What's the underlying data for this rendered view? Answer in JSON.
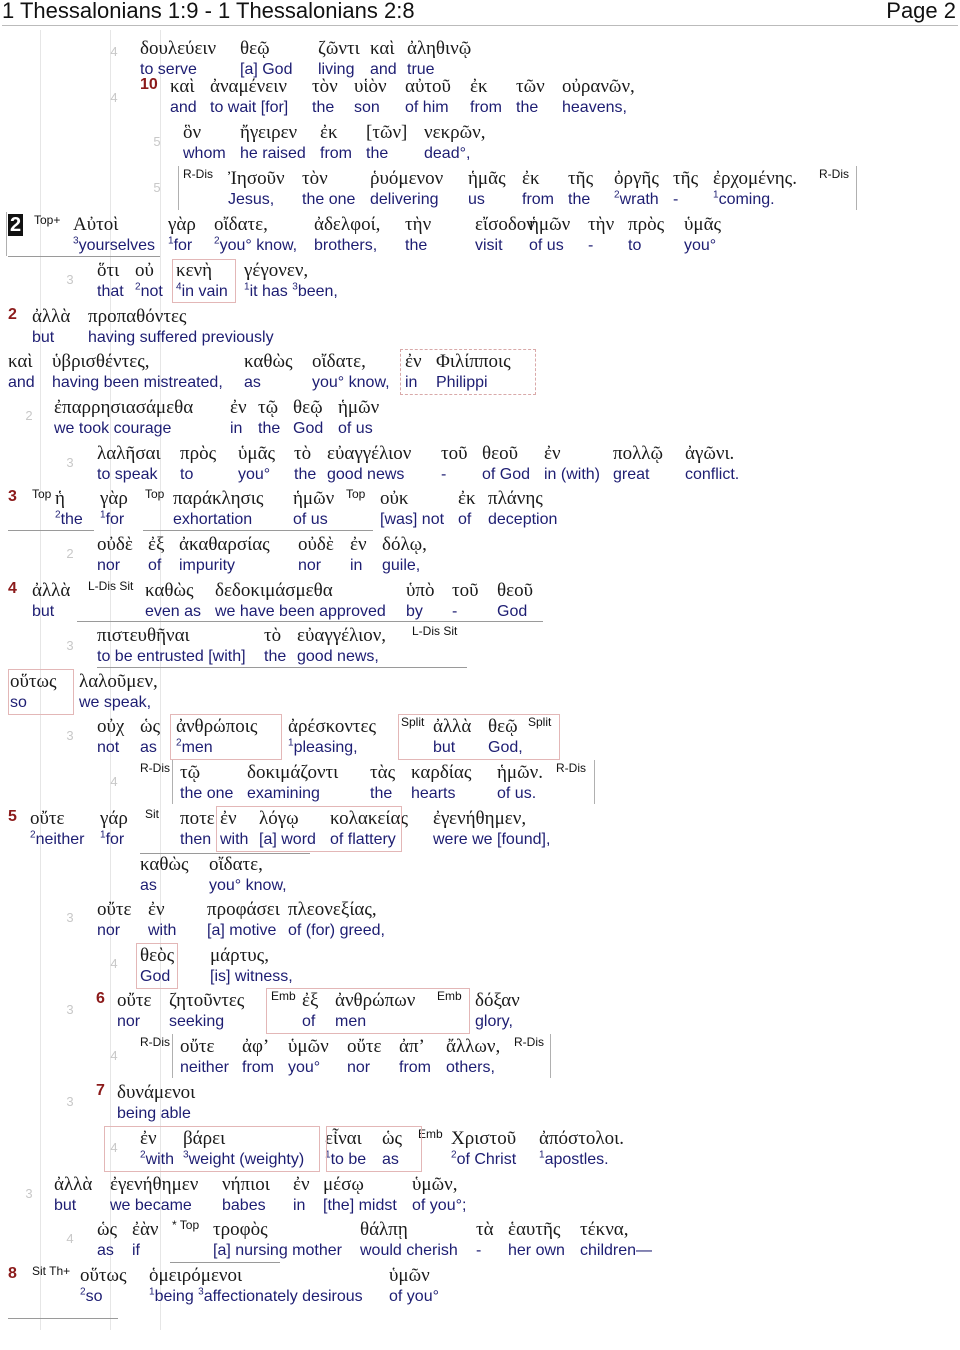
{
  "header": {
    "title": "1 Thessalonians 1:9 - 1 Thessalonians 2:8",
    "page": "Page 2"
  },
  "chapter_label": "2",
  "verses": [
    "10",
    "2",
    "3",
    "4",
    "5",
    "6",
    "7",
    "8"
  ],
  "tags": {
    "rdis": "R-Dis",
    "topplus": "Top+",
    "top": "Top",
    "ldissit": "L-Dis Sit",
    "split": "Split",
    "sit": "Sit",
    "emb": "Emb",
    "startop": "* Top",
    "sitth": "Sit Th+"
  },
  "levels": [
    "4",
    "4",
    "5",
    "5",
    "3",
    "2",
    "3",
    "2",
    "3",
    "3",
    "4",
    "3",
    "4",
    "3",
    "4",
    "3",
    "4",
    "3",
    "4",
    "2",
    "3"
  ],
  "lines": [
    [
      [
        "δουλεύειν",
        "to serve"
      ],
      [
        "θεῷ",
        "[a] God"
      ],
      [
        "ζῶντι",
        "living"
      ],
      [
        "καὶ",
        "and"
      ],
      [
        "ἀληθινῷ",
        "true"
      ]
    ],
    [
      [
        "καὶ",
        "and"
      ],
      [
        "ἀναμένειν",
        "to wait [for]"
      ],
      [
        "τὸν",
        "the"
      ],
      [
        "υἱὸν",
        "son"
      ],
      [
        "αὐτοῦ",
        "of him"
      ],
      [
        "ἐκ",
        "from"
      ],
      [
        "τῶν",
        "the"
      ],
      [
        "οὐρανῶν,",
        "heavens,"
      ]
    ],
    [
      [
        "ὃν",
        "whom"
      ],
      [
        "ἤγειρεν",
        "he raised"
      ],
      [
        "ἐκ",
        "from"
      ],
      [
        "[τῶν]",
        "the"
      ],
      [
        "νεκρῶν,",
        "dead°,"
      ]
    ],
    [
      [
        "Ἰησοῦν",
        "Jesus,"
      ],
      [
        "τὸν",
        "the one"
      ],
      [
        "ῥυόμενον",
        "delivering"
      ],
      [
        "ἡμᾶς",
        "us"
      ],
      [
        "ἐκ",
        "from"
      ],
      [
        "τῆς",
        "the"
      ],
      [
        "ὀργῆς",
        "²wrath"
      ],
      [
        "τῆς",
        "-"
      ],
      [
        "ἐρχομένης.",
        "¹coming."
      ]
    ],
    [
      [
        "Αὐτοὶ",
        "³yourselves"
      ],
      [
        "γὰρ",
        "¹for"
      ],
      [
        "οἴδατε,",
        "²you° know,"
      ],
      [
        "ἀδελφοί,",
        "brothers,"
      ],
      [
        "τὴν",
        "the"
      ],
      [
        "εἴσοδον",
        "visit"
      ],
      [
        "ἡμῶν",
        "of us"
      ],
      [
        "τὴν",
        "-"
      ],
      [
        "πρὸς",
        "to"
      ],
      [
        "ὑμᾶς",
        "you°"
      ]
    ],
    [
      [
        "ὅτι",
        "that"
      ],
      [
        "οὐ",
        "²not"
      ],
      [
        "κενὴ",
        "⁴in vain"
      ],
      [
        "γέγονεν,",
        "¹it has ³been,"
      ]
    ],
    [
      [
        "ἀλλὰ",
        "but"
      ],
      [
        "προπαθόντες",
        "having suffered previously"
      ]
    ],
    [
      [
        "καὶ",
        "and"
      ],
      [
        "ὑβρισθέντες,",
        "having been mistreated,"
      ],
      [
        "καθὼς",
        "as"
      ],
      [
        "οἴδατε,",
        "you° know,"
      ],
      [
        "ἐν",
        "in"
      ],
      [
        "Φιλίπποις",
        "Philippi"
      ]
    ],
    [
      [
        "ἐπαρρησιασάμεθα",
        "we took courage"
      ],
      [
        "ἐν",
        "in"
      ],
      [
        "τῷ",
        "the"
      ],
      [
        "θεῷ",
        "God"
      ],
      [
        "ἡμῶν",
        "of us"
      ]
    ],
    [
      [
        "λαλῆσαι",
        "to speak"
      ],
      [
        "πρὸς",
        "to"
      ],
      [
        "ὑμᾶς",
        "you°"
      ],
      [
        "τὸ",
        "the"
      ],
      [
        "εὐαγγέλιον",
        "good news"
      ],
      [
        "τοῦ",
        "-"
      ],
      [
        "θεοῦ",
        "of God"
      ],
      [
        "ἐν",
        "in (with)"
      ],
      [
        "πολλῷ",
        "great"
      ],
      [
        "ἀγῶνι.",
        "conflict."
      ]
    ],
    [
      [
        "ἡ",
        "²the"
      ],
      [
        "γὰρ",
        "¹for"
      ],
      [
        "παράκλησις",
        "exhortation"
      ],
      [
        "ἡμῶν",
        "of us"
      ],
      [
        "οὐκ",
        "[was] not"
      ],
      [
        "ἐκ",
        "of"
      ],
      [
        "πλάνης",
        "deception"
      ]
    ],
    [
      [
        "οὐδὲ",
        "nor"
      ],
      [
        "ἐξ",
        "of"
      ],
      [
        "ἀκαθαρσίας",
        "impurity"
      ],
      [
        "οὐδὲ",
        "nor"
      ],
      [
        "ἐν",
        "in"
      ],
      [
        "δόλῳ,",
        "guile,"
      ]
    ],
    [
      [
        "ἀλλὰ",
        "but"
      ],
      [
        "καθὼς",
        "even as"
      ],
      [
        "δεδοκιμάσμεθα",
        "we have been approved"
      ],
      [
        "ὑπὸ",
        "by"
      ],
      [
        "τοῦ",
        "-"
      ],
      [
        "θεοῦ",
        "God"
      ]
    ],
    [
      [
        "πιστευθῆναι",
        "to be entrusted [with]"
      ],
      [
        "τὸ",
        "the"
      ],
      [
        "εὐαγγέλιον,",
        "good news,"
      ]
    ],
    [
      [
        "οὕτως",
        "so"
      ],
      [
        "λαλοῦμεν,",
        "we speak,"
      ]
    ],
    [
      [
        "οὐχ",
        "not"
      ],
      [
        "ὡς",
        "as"
      ],
      [
        "ἀνθρώποις",
        "²men"
      ],
      [
        "ἀρέσκοντες",
        "¹pleasing,"
      ],
      [
        "ἀλλὰ",
        "but"
      ],
      [
        "θεῷ",
        "God,"
      ]
    ],
    [
      [
        "τῷ",
        "the one"
      ],
      [
        "δοκιμάζοντι",
        "examining"
      ],
      [
        "τὰς",
        "the"
      ],
      [
        "καρδίας",
        "hearts"
      ],
      [
        "ἡμῶν.",
        "of us."
      ]
    ],
    [
      [
        "οὔτε",
        "²neither"
      ],
      [
        "γάρ",
        "¹for"
      ],
      [
        "ποτε",
        "then"
      ],
      [
        "ἐν",
        "with"
      ],
      [
        "λόγῳ",
        "[a] word"
      ],
      [
        "κολακείας",
        "of flattery"
      ],
      [
        "ἐγενήθημεν,",
        "were we [found],"
      ]
    ],
    [
      [
        "καθὼς",
        "as"
      ],
      [
        "οἴδατε,",
        "you° know,"
      ]
    ],
    [
      [
        "οὔτε",
        "nor"
      ],
      [
        "ἐν",
        "with"
      ],
      [
        "προφάσει",
        "[a] motive"
      ],
      [
        "πλεονεξίας,",
        "of (for) greed,"
      ]
    ],
    [
      [
        "θεὸς",
        "God"
      ],
      [
        "μάρτυς,",
        "[is] witness,"
      ]
    ],
    [
      [
        "οὔτε",
        "nor"
      ],
      [
        "ζητοῦντες",
        "seeking"
      ],
      [
        "ἐξ",
        "of"
      ],
      [
        "ἀνθρώπων",
        "men"
      ],
      [
        "δόξαν",
        "glory,"
      ]
    ],
    [
      [
        "οὔτε",
        "neither"
      ],
      [
        "ἀφ’",
        "from"
      ],
      [
        "ὑμῶν",
        "you°"
      ],
      [
        "οὔτε",
        "nor"
      ],
      [
        "ἀπ’",
        "from"
      ],
      [
        "ἄλλων,",
        "others,"
      ]
    ],
    [
      [
        "δυνάμενοι",
        "being able"
      ]
    ],
    [
      [
        "ἐν",
        "²with"
      ],
      [
        "βάρει",
        "³weight (weighty)"
      ],
      [
        "εἶναι",
        "¹to be"
      ],
      [
        "ὡς",
        "as"
      ],
      [
        "Χριστοῦ",
        "²of Christ"
      ],
      [
        "ἀπόστολοι.",
        "¹apostles."
      ]
    ],
    [
      [
        "ἀλλὰ",
        "but"
      ],
      [
        "ἐγενήθημεν",
        "we became"
      ],
      [
        "νήπιοι",
        "babes"
      ],
      [
        "ἐν",
        "in"
      ],
      [
        "μέσῳ",
        "[the] midst"
      ],
      [
        "ὑμῶν,",
        "of you°;"
      ]
    ],
    [
      [
        "ὡς",
        "as"
      ],
      [
        "ἐὰν",
        "if"
      ],
      [
        "τροφὸς",
        "[a] nursing mother"
      ],
      [
        "θάλπῃ",
        "would cherish"
      ],
      [
        "τὰ",
        "-"
      ],
      [
        "ἑαυτῆς",
        "her own"
      ],
      [
        "τέκνα,",
        "children—"
      ]
    ],
    [
      [
        "οὕτως",
        "²so"
      ],
      [
        "ὁμειρόμενοι",
        "¹being ³affectionately desirous"
      ],
      [
        "ὑμῶν",
        "of you°"
      ]
    ]
  ]
}
